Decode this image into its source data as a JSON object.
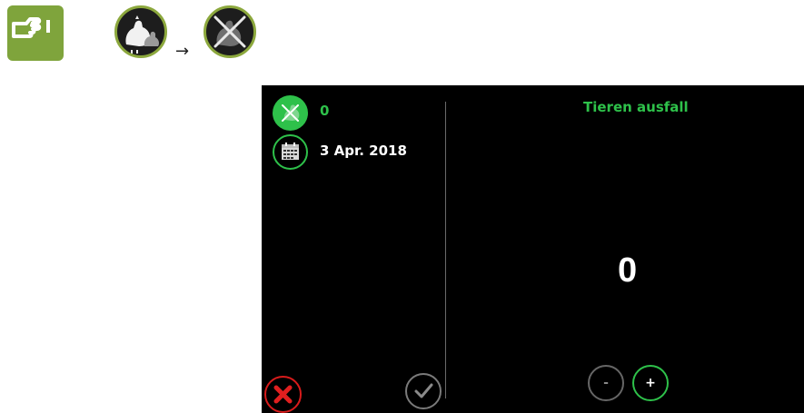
{
  "header": {
    "flow_arrow": "→",
    "icons": [
      "pointing-hand-icon",
      "chickens-icon",
      "dead-chicken-icon"
    ]
  },
  "sidebar": {
    "mortality_value": "0",
    "date_value": "3 Apr. 2018"
  },
  "main": {
    "title": "Tieren ausfall",
    "counter_value": "0",
    "decrement_label": "-",
    "increment_label": "+"
  },
  "colors": {
    "accent_green": "#2ec14a",
    "tile_green": "#7fa43c",
    "cancel_red": "#d81b1b",
    "panel_bg": "#000000"
  }
}
